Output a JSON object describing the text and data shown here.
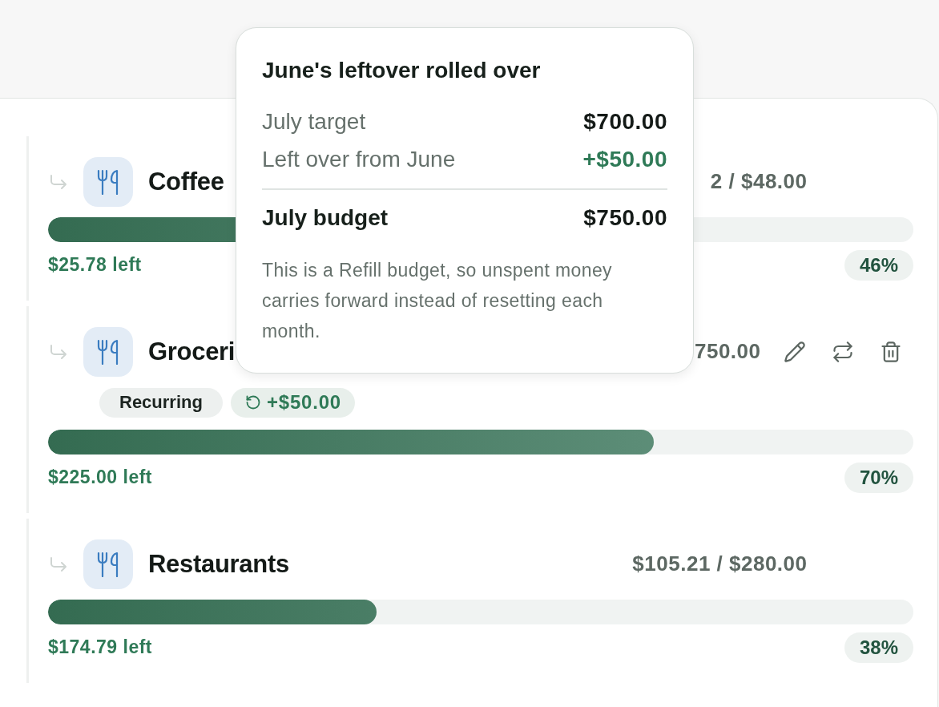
{
  "budgets": [
    {
      "name": "Coffee",
      "amount": "2 / $48.00",
      "hovered": false,
      "level": 0.46,
      "left": "$25.78 left",
      "percent": "46%"
    },
    {
      "name": "Groceri",
      "amount": "750.00",
      "hovered": true,
      "tags": [
        {
          "kind": "recurring",
          "label": "Recurring"
        },
        {
          "kind": "rollover",
          "label": "+$50.00"
        }
      ],
      "level": 0.7,
      "left": "$225.00 left",
      "percent": "70%"
    },
    {
      "name": "Restaurants",
      "amount": "$105.21 / $280.00",
      "hovered": false,
      "level": 0.38,
      "left": "$174.79 left",
      "percent": "38%"
    }
  ],
  "popover": {
    "title": "June's leftover rolled over",
    "lines": [
      {
        "kind": "base",
        "label": "July target",
        "value": "$700.00"
      },
      {
        "kind": "rollover",
        "label": "Left over from June",
        "value": "+$50.00"
      },
      {
        "kind": "total",
        "label": "July budget",
        "value": "$750.00"
      }
    ],
    "note": "This is a Refill budget, so unspent money carries forward instead of resetting each month."
  }
}
